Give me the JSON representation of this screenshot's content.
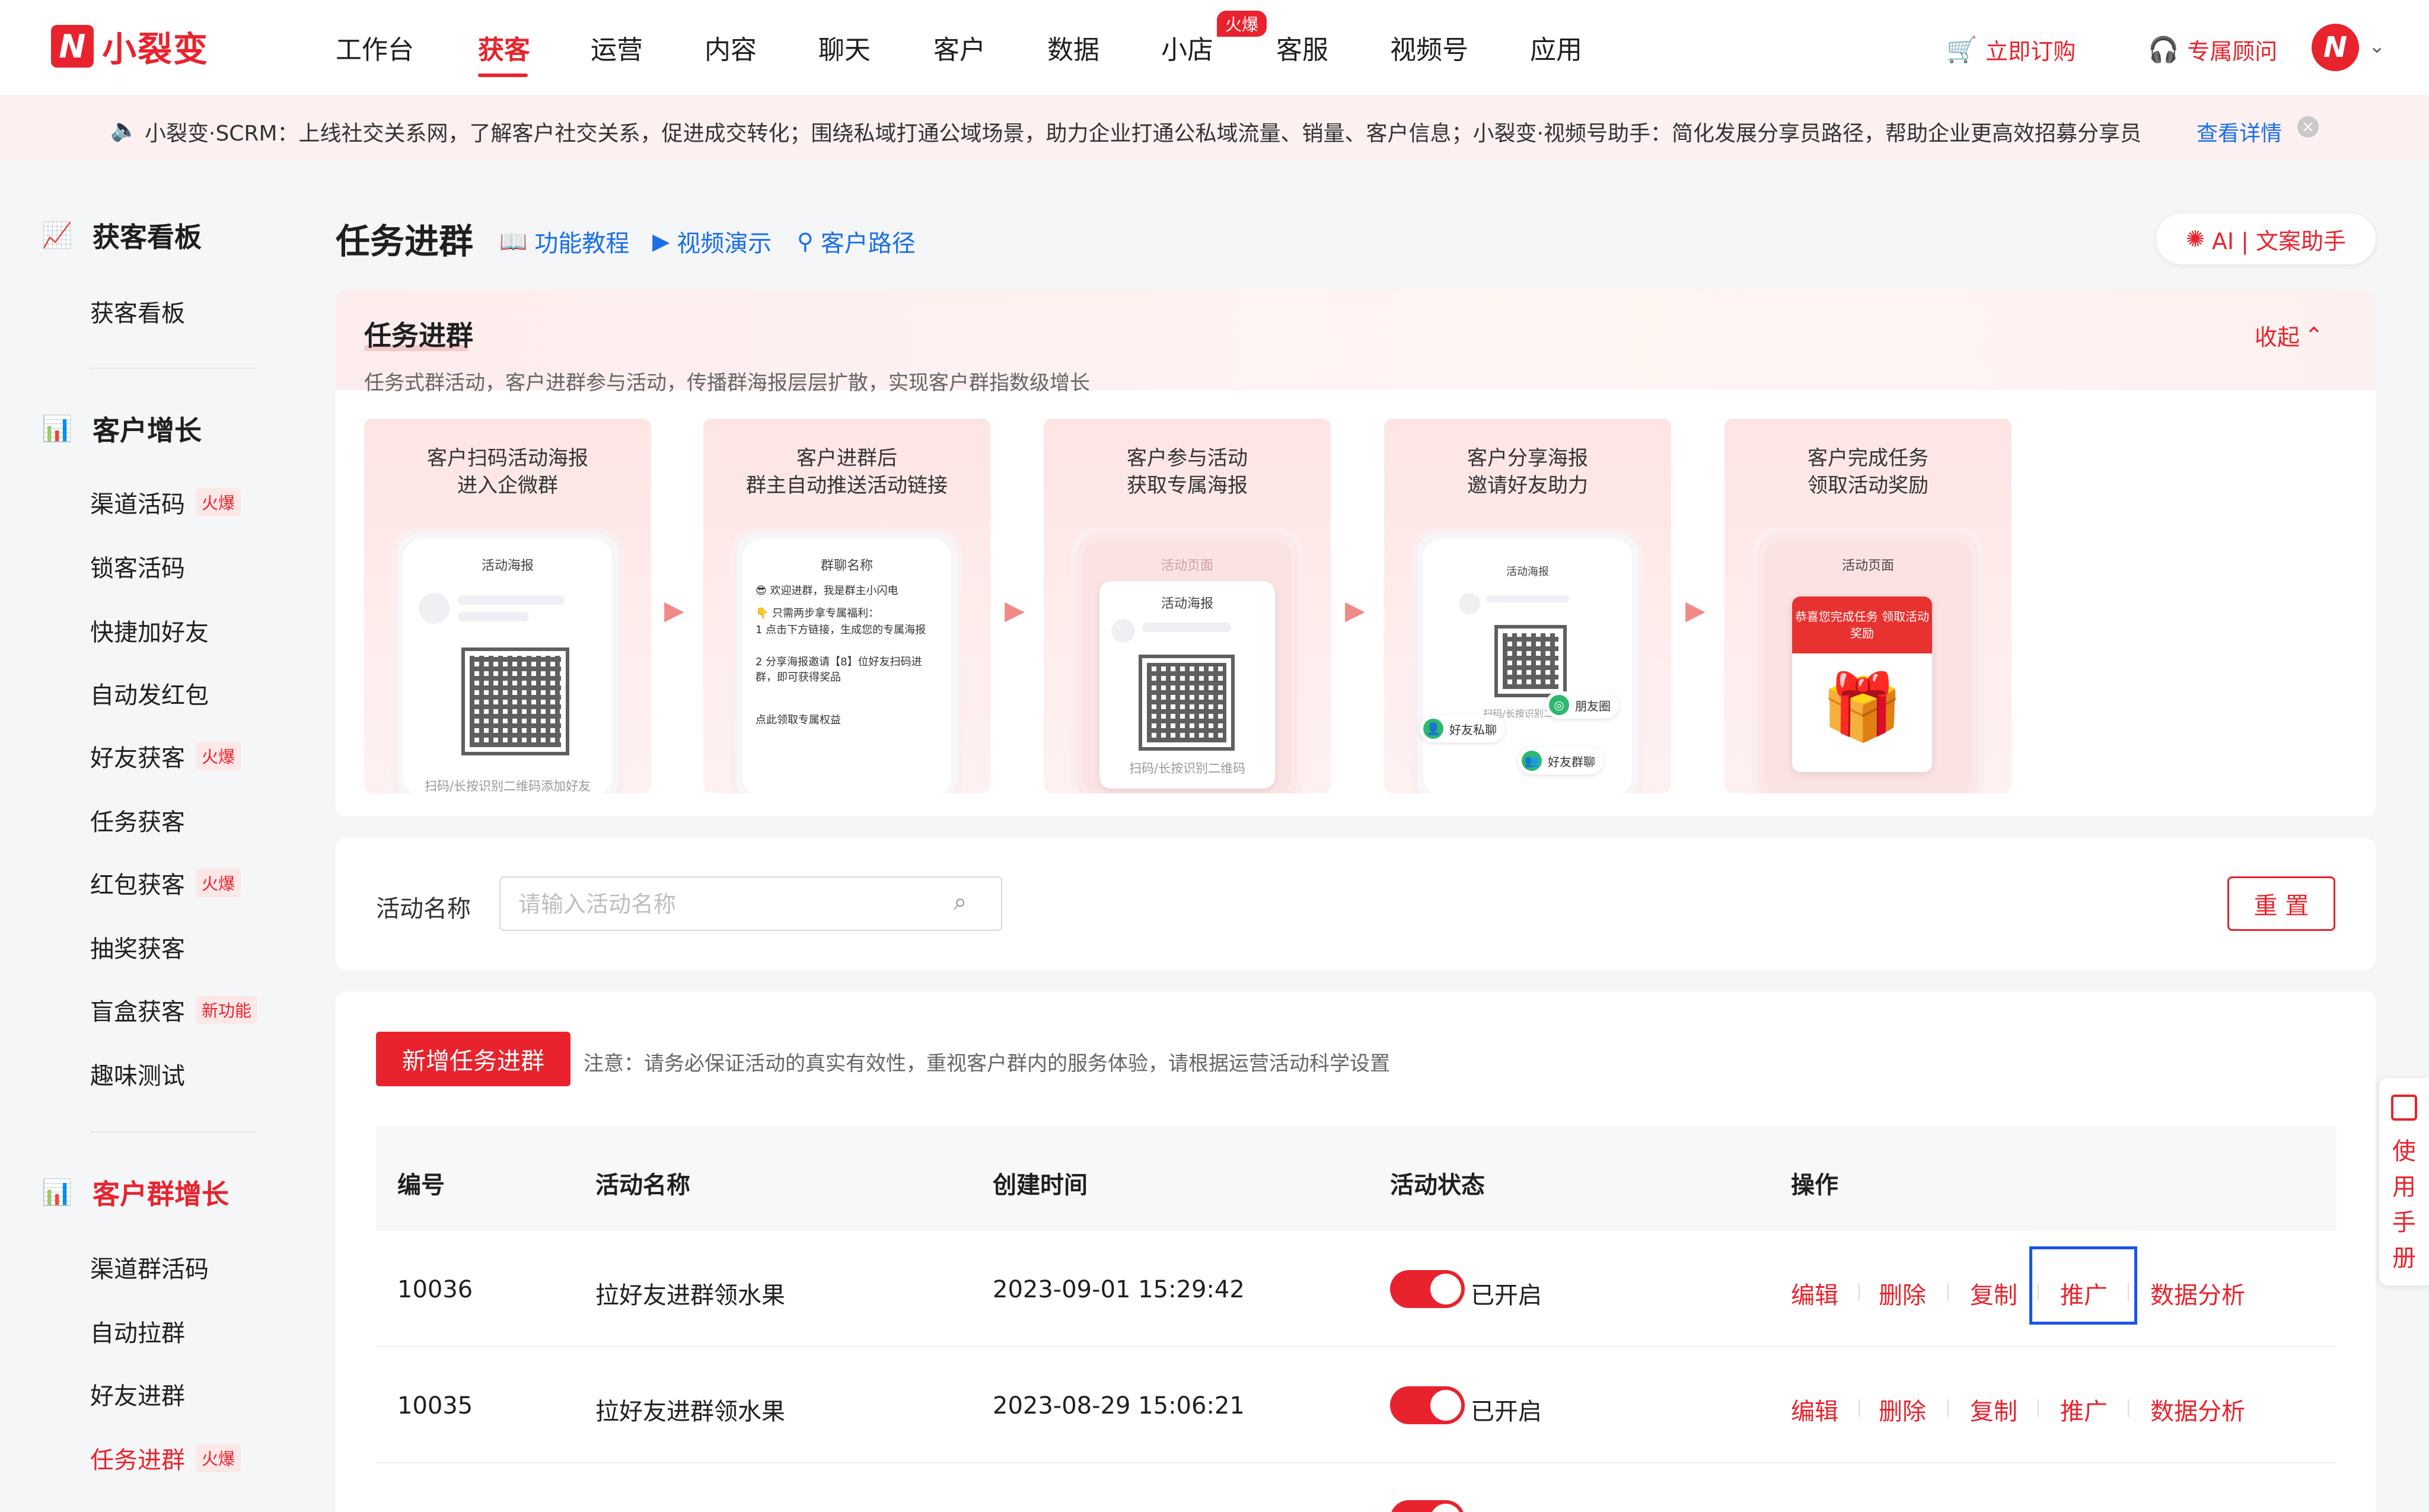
{
  "topnav": {
    "logo_mark": "N",
    "logo_text": "小裂变",
    "items": [
      "工作台",
      "获客",
      "运营",
      "内容",
      "聊天",
      "客户",
      "数据",
      "小店",
      "客服",
      "视频号",
      "应用"
    ],
    "active": "获客",
    "hot_badge": "火爆",
    "subscribe": "立即订购",
    "consultant": "专属顾问",
    "avatar": "N"
  },
  "notice": {
    "text": "小裂变·SCRM：上线社交关系网，了解客户社交关系，促进成交转化；围绕私域打通公域场景，助力企业打通公私域流量、销量、客户信息；小裂变·视频号助手：简化发展分享员路径，帮助企业更高效招募分享员",
    "link": "查看详情"
  },
  "sidebar": {
    "section1": {
      "title": "获客看板",
      "items": [
        {
          "label": "获客看板"
        }
      ]
    },
    "section2": {
      "title": "客户增长",
      "items": [
        {
          "label": "渠道活码",
          "tag": "火爆"
        },
        {
          "label": "锁客活码"
        },
        {
          "label": "快捷加好友"
        },
        {
          "label": "自动发红包"
        },
        {
          "label": "好友获客",
          "tag": "火爆"
        },
        {
          "label": "任务获客"
        },
        {
          "label": "红包获客",
          "tag": "火爆"
        },
        {
          "label": "抽奖获客"
        },
        {
          "label": "盲盒获客",
          "tag": "新功能"
        },
        {
          "label": "趣味测试"
        }
      ]
    },
    "section3": {
      "title": "客户群增长",
      "items": [
        {
          "label": "渠道群活码"
        },
        {
          "label": "自动拉群"
        },
        {
          "label": "好友进群"
        },
        {
          "label": "任务进群",
          "tag": "火爆"
        }
      ]
    }
  },
  "header": {
    "title": "任务进群",
    "links": [
      "功能教程",
      "视频演示",
      "客户路径"
    ],
    "ai_button": "AI | 文案助手"
  },
  "intro": {
    "title": "任务进群",
    "subtitle": "任务式群活动，客户进群参与活动，传播群海报层层扩散，实现客户群指数级增长",
    "collapse": "收起",
    "steps": [
      {
        "line1": "客户扫码活动海报",
        "line2": "进入企微群",
        "screen_title": "活动海报",
        "footer": "扫码/长按识别二维码添加好友"
      },
      {
        "line1": "客户进群后",
        "line2": "群主自动推送活动链接",
        "screen_title": "群聊名称",
        "chat": [
          "😎 欢迎进群，我是群主小闪电",
          "👇 只需两步拿专属福利：",
          "1 点击下方链接，生成您的专属海报",
          "2 分享海报邀请【8】位好友扫码进群，即可获得奖品",
          "点此领取专属权益"
        ]
      },
      {
        "line1": "客户参与活动",
        "line2": "获取专属海报",
        "screen_title": "活动页面",
        "card_title": "活动海报",
        "footer": "扫码/长按识别二维码"
      },
      {
        "line1": "客户分享海报",
        "line2": "邀请好友助力",
        "screen_title": "活动海报",
        "footer": "扫码/长按识别二维码",
        "chips": [
          "好友私聊",
          "朋友圈",
          "好友群聊"
        ]
      },
      {
        "line1": "客户完成任务",
        "line2": "领取活动奖励",
        "screen_title": "活动页面",
        "reward": "恭喜您完成任务 领取活动奖励"
      }
    ]
  },
  "filter": {
    "label": "活动名称",
    "placeholder": "请输入活动名称",
    "value": "",
    "reset": "重 置"
  },
  "table": {
    "add_button": "新增任务进群",
    "note": "注意：请务必保证活动的真实有效性，重视客户群内的服务体验，请根据运营活动科学设置",
    "columns": [
      "编号",
      "活动名称",
      "创建时间",
      "活动状态",
      "操作"
    ],
    "rows": [
      {
        "id": "10036",
        "name": "拉好友进群领水果",
        "created": "2023-09-01 15:29:42",
        "status": "已开启",
        "enabled": true
      },
      {
        "id": "10035",
        "name": "拉好友进群领水果",
        "created": "2023-08-29 15:06:21",
        "status": "已开启",
        "enabled": true
      }
    ],
    "actions": [
      "编辑",
      "删除",
      "复制",
      "推广",
      "数据分析"
    ]
  },
  "manual": {
    "label": "使用手册"
  },
  "colors": {
    "brand": "#e8232d",
    "link": "#1a6fe8",
    "focus": "#1a56e8"
  }
}
